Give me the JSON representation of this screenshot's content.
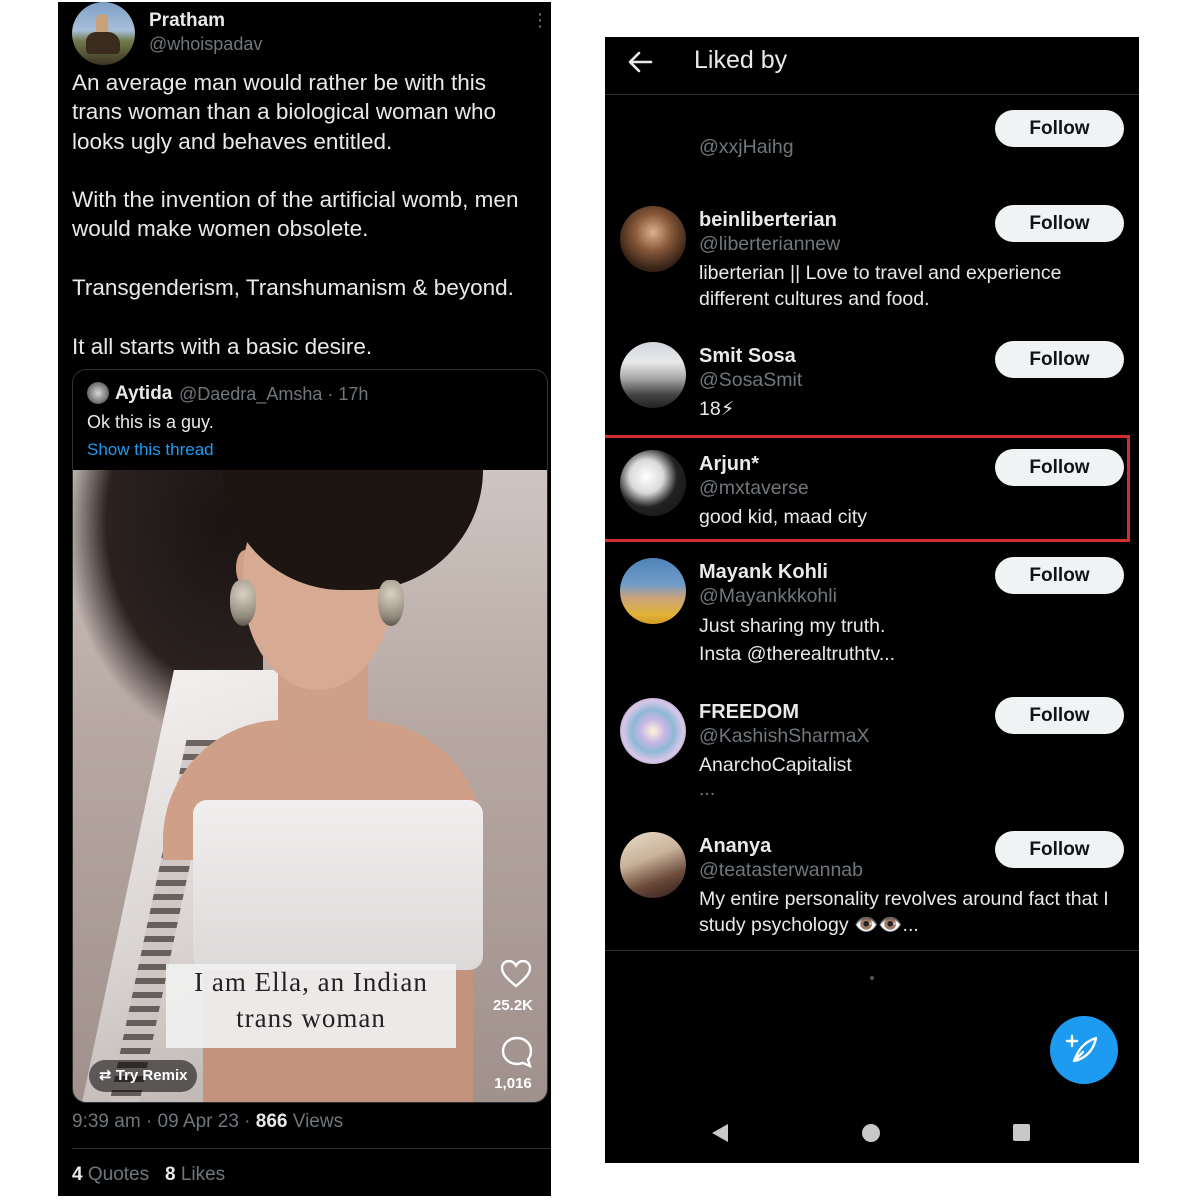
{
  "tweet": {
    "author_name": "Pratham",
    "author_handle": "@whoispadav",
    "paragraphs": [
      "An average man would rather be with this trans woman than a biological woman who looks ugly and behaves entitled.",
      "With the invention of the artificial womb, men would make women obsolete.",
      "Transgenderism, Transhumanism & beyond.",
      "It all starts with a basic desire."
    ],
    "quote": {
      "author_name": "Aytida",
      "author_handle": "@Daedra_Amsha · 17h",
      "text": "Ok this is a guy.",
      "thread_link": "Show this thread",
      "media": {
        "caption_line1": "I am Ella, an Indian",
        "caption_line2": "trans woman",
        "remix_label": "Try Remix",
        "likes": "25.2K",
        "comments": "1,016"
      }
    },
    "meta": {
      "time": "9:39 am · 09 Apr 23 · ",
      "views_count": "866",
      "views_label": " Views"
    },
    "stats": {
      "quotes_count": "4",
      "quotes_label": " Quotes",
      "likes_count": "8",
      "likes_label": " Likes"
    }
  },
  "liked_by": {
    "title": "Liked by",
    "follow_label": "Follow",
    "users": [
      {
        "name": "",
        "handle": "@xxjHaihg",
        "bio": ""
      },
      {
        "name": "beinliberterian",
        "handle": "@liberteriannew",
        "bio": "liberterian || Love to travel and experience different cultures and food."
      },
      {
        "name": "Smit Sosa",
        "handle": "@SosaSmit",
        "bio": "18⚡"
      },
      {
        "name": "Arjun*",
        "handle": "@mxtaverse",
        "bio": "good kid, maad city"
      },
      {
        "name": "Mayank Kohli",
        "handle": "@Mayankkkohli",
        "bio_line1": "Just sharing my truth.",
        "bio_line2": "Insta @therealtruthtv..."
      },
      {
        "name": "FREEDOM",
        "handle": "@KashishSharmaX",
        "bio_line1": "AnarchoCapitalist",
        "bio_line2": "..."
      },
      {
        "name": "Ananya",
        "handle": "@teatasterwannab",
        "bio": "My entire personality revolves around fact that I study psychology 👁️👁️..."
      }
    ]
  },
  "colors": {
    "background": "#000000",
    "accent": "#1d9bf0",
    "secondary_text": "#71767b",
    "highlight_box": "#d32f2f"
  }
}
